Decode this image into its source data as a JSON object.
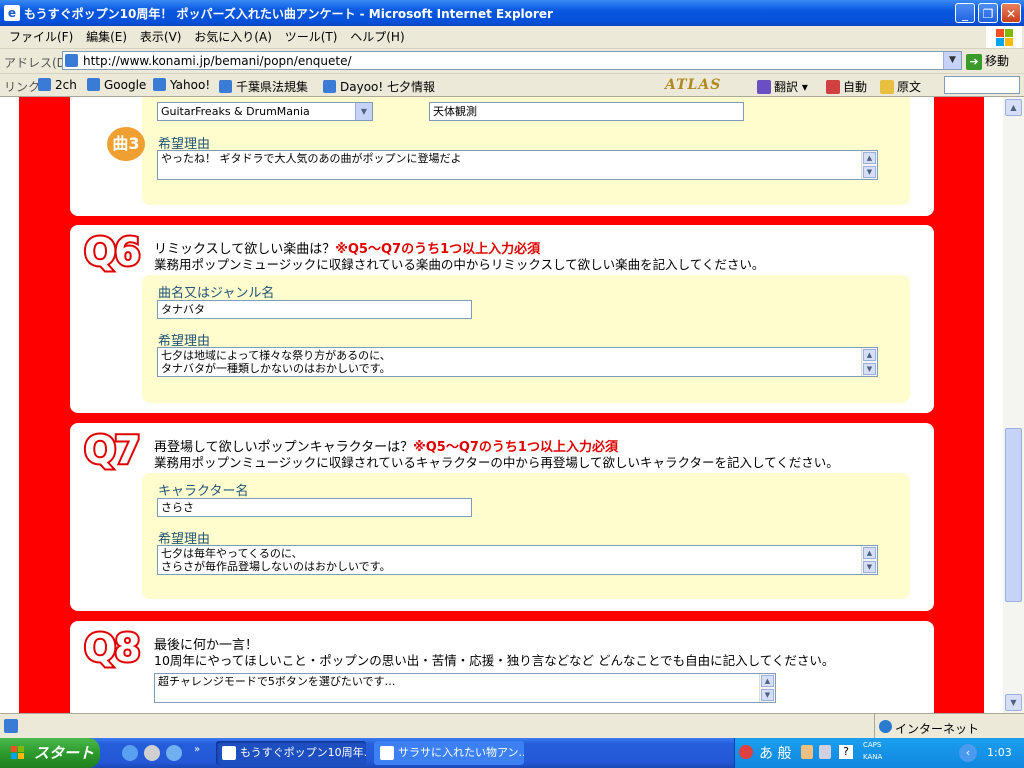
{
  "window": {
    "title": "もうすぐポップン10周年！ ポッパーズ入れたい曲アンケート - Microsoft Internet Explorer",
    "controls": {
      "minimize": "_",
      "maximize": "❐",
      "close": "✕"
    }
  },
  "menu": [
    "ファイル(F)",
    "編集(E)",
    "表示(V)",
    "お気に入り(A)",
    "ツール(T)",
    "ヘルプ(H)"
  ],
  "address": {
    "label": "アドレス(D)",
    "url": "http://www.konami.jp/bemani/popn/enquete/",
    "go": "移動"
  },
  "links": {
    "label": "リンク",
    "items": [
      "2ch",
      "Google",
      "Yahoo!",
      "千葉県法規集",
      "Dayoo! 七夕情報"
    ]
  },
  "toolbar_right": {
    "atlas": "ATLAS",
    "translate": "翻訳",
    "auto": "自動",
    "original": "原文"
  },
  "q5": {
    "genre_select": "GuitarFreaks & DrumMania",
    "song_input": "天体観測",
    "badge": "曲3",
    "reason_label": "希望理由",
    "reason_text": "やったね！ ギタドラで大人気のあの曲がポップンに登場だよ"
  },
  "q6": {
    "icon": "Q6",
    "title": "リミックスして欲しい楽曲は？",
    "required": "※Q5～Q7のうち1つ以上入力必須",
    "desc": "業務用ポップンミュージックに収録されている楽曲の中からリミックスして欲しい楽曲を記入してください。",
    "name_label": "曲名又はジャンル名",
    "name_value": "タナバタ",
    "reason_label": "希望理由",
    "reason_line1": "七夕は地域によって様々な祭り方があるのに、",
    "reason_line2": "タナバタが一種類しかないのはおかしいです。"
  },
  "q7": {
    "icon": "Q7",
    "title": "再登場して欲しいポップンキャラクターは？",
    "required": "※Q5～Q7のうち1つ以上入力必須",
    "desc": "業務用ポップンミュージックに収録されているキャラクターの中から再登場して欲しいキャラクターを記入してください。",
    "name_label": "キャラクター名",
    "name_value": "さらさ",
    "reason_label": "希望理由",
    "reason_line1": "七夕は毎年やってくるのに、",
    "reason_line2": "さらさが毎作品登場しないのはおかしいです。"
  },
  "q8": {
    "icon": "Q8",
    "title": "最後に何か一言！",
    "desc": "10周年にやってほしいこと・ポップンの思い出・苦情・応援・独り言などなど どんなことでも自由に記入してください。",
    "value": "超チャレンジモードで5ボタンを選びたいです…"
  },
  "status": {
    "zone": "インターネット"
  },
  "taskbar": {
    "start": "スタート",
    "items": [
      "もうすぐポップン10周年...",
      "サラサに入れたい物アン..."
    ],
    "ime": "あ 般",
    "caps": "CAPS",
    "kana": "KANA",
    "clock": "1:03"
  },
  "colors": {
    "page_red": "#ff0000",
    "panel_yellow": "#fffcce",
    "required_red": "#e00000",
    "label_blue": "#225577"
  }
}
